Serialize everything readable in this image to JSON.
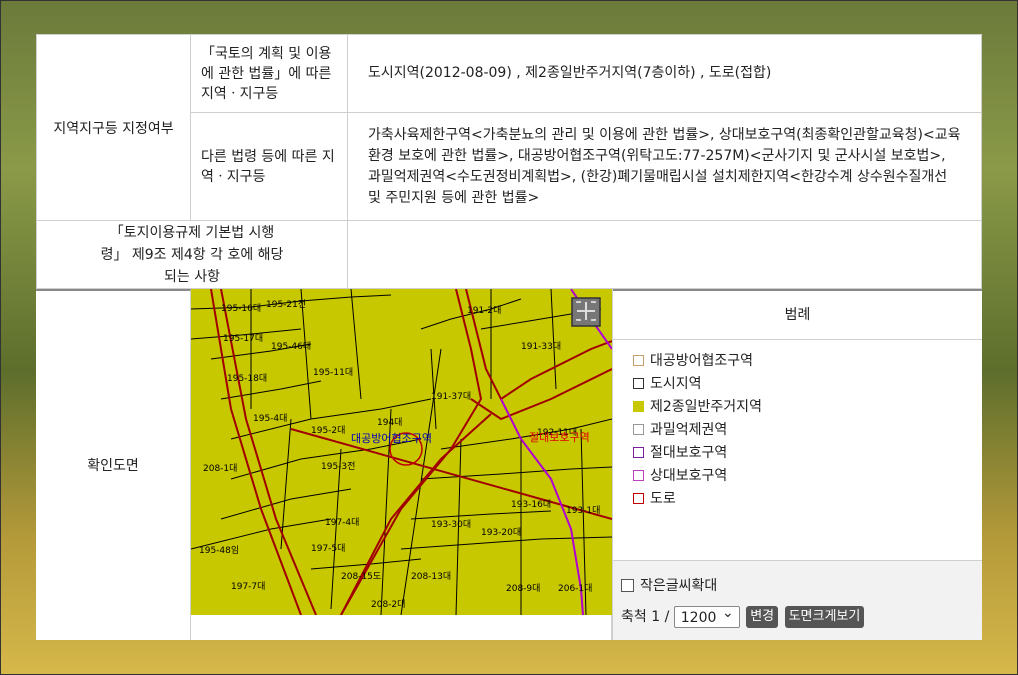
{
  "zoning": {
    "row_header": "지역지구등 지정여부",
    "national_label": "「국토의 계획 및 이용에 관한 법률」에 따른 지역ㆍ지구등",
    "national_value": "도시지역(2012-08-09) , 제2종일반주거지역(7층이하) , 도로(접합)",
    "other_label": "다른 법령 등에 따른 지역ㆍ지구등",
    "other_value": "가축사육제한구역<가축분뇨의 관리 및 이용에 관한 법률>, 상대보호구역(최종확인관할교육청)<교육환경 보호에 관한 법률>, 대공방어협조구역(위탁고도:77-257M)<군사기지 및 군사시설 보호법>, 과밀억제권역<수도권정비계획법>, (한강)폐기물매립시설 설치제한지역<한강수계 상수원수질개선 및 주민지원 등에 관한 법률>"
  },
  "decree": {
    "label": "「토지이용규제 기본법 시행령」 제9조 제4항 각 호에 해당되는 사항",
    "value": ""
  },
  "map_section": {
    "header": "확인도면",
    "legend_title": "범례",
    "legend": [
      {
        "label": "대공방어협조구역",
        "color": "#c8a070",
        "fill": "#ffffff"
      },
      {
        "label": "도시지역",
        "color": "#333333",
        "fill": "#ffffff"
      },
      {
        "label": "제2종일반주거지역",
        "color": "#c8c800",
        "fill": "#c8c800"
      },
      {
        "label": "과밀억제권역",
        "color": "#999999",
        "fill": "#ffffff"
      },
      {
        "label": "절대보호구역",
        "color": "#7a1fa0",
        "fill": "#ffffff"
      },
      {
        "label": "상대보호구역",
        "color": "#c040c0",
        "fill": "#ffffff"
      },
      {
        "label": "도로",
        "color": "#c00000",
        "fill": "#ffffff"
      }
    ],
    "small_text_label": "작은글씨확대",
    "scale_label": "축척 1 /",
    "scale_value": "1200",
    "change_button": "변경",
    "large_view_button": "도면크게보기"
  },
  "map_labels": {
    "p1": "195-16대",
    "p2": "195-21전",
    "p3": "195-17대",
    "p4": "195-46대",
    "p5": "195-18대",
    "p6": "195-11대",
    "p7": "195-4대",
    "p8": "195-2대",
    "p9": "194대",
    "p10": "195-3전",
    "p11": "191-2대",
    "p12": "191-33대",
    "p13": "191-37대",
    "p14": "192-11대",
    "p15": "193-16대",
    "p16": "193-1대",
    "p17": "193-30대",
    "p18": "193-20대",
    "p19": "195-48임",
    "p20": "197-4대",
    "p21": "197-5대",
    "p22": "197-7대",
    "p23": "208-15도",
    "p24": "208-13대",
    "p25": "208-2대",
    "p26": "208-9대",
    "p27": "206-1대",
    "p28": "208-1대",
    "z1": "대공방어협조구역",
    "z2": "절대보호구역"
  },
  "colors": {
    "map_fill": "#c8c800",
    "road_line": "#a00000",
    "abs_zone_line": "#b000d0",
    "parcel_line": "#000000"
  }
}
